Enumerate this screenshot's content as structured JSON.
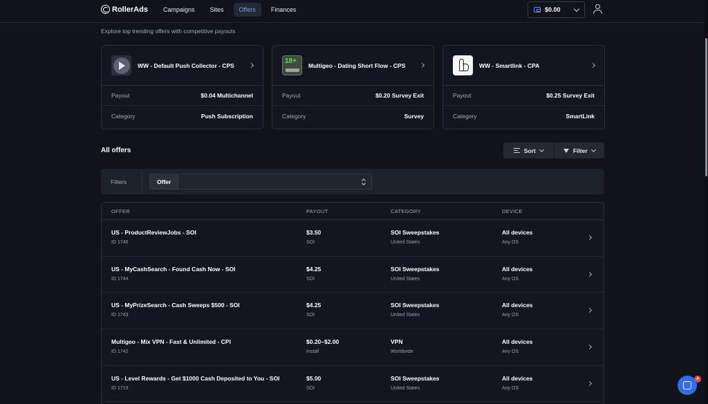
{
  "header": {
    "brand": "RollerAds",
    "nav": [
      "Campaigns",
      "Sites",
      "Offers",
      "Finances"
    ],
    "active_nav": "Offers",
    "balance": "$0.00"
  },
  "subtitle": "Explore top trending offers with competitive payouts",
  "top_offers": [
    {
      "title": "WW - Default Push Collector - CPS",
      "payout_label": "Payout",
      "payout": "$0.04 Multichannel",
      "category_label": "Category",
      "category": "Push Subscription",
      "icon": "play-icon"
    },
    {
      "title": "Multigeo - Dating Short Flow - CPS",
      "payout_label": "Payout",
      "payout": "$0.20 Survey Exit",
      "category_label": "Category",
      "category": "Survey",
      "icon": "18-plus-icon",
      "thumb_text": "18+"
    },
    {
      "title": "WW - Smartlink - CPA",
      "payout_label": "Payout",
      "payout": "$0.25 Survey Exit",
      "category_label": "Category",
      "category": "SmartLink",
      "icon": "pointer-hand-icon"
    }
  ],
  "all_offers": {
    "title": "All offers",
    "sort_label": "Sort",
    "filter_label": "Filter",
    "filters_label": "Filters",
    "offer_tag": "Offer",
    "columns": [
      "OFFER",
      "PAYOUT",
      "CATEGORY",
      "DEVICE"
    ],
    "rows": [
      {
        "name": "US - ProductReviewJobs - SOI",
        "id": "ID 1746",
        "payout": "$3.50",
        "payout_type": "SOI",
        "category": "SOI Sweepstakes",
        "geo": "United States",
        "device": "All devices",
        "os": "Any OS"
      },
      {
        "name": "US - MyCashSearch - Found Cash Now - SOI",
        "id": "ID 1744",
        "payout": "$4.25",
        "payout_type": "SOI",
        "category": "SOI Sweepstakes",
        "geo": "United States",
        "device": "All devices",
        "os": "Any OS"
      },
      {
        "name": "US - MyPrizeSearch - Cash Sweeps $500 - SOI",
        "id": "ID 1743",
        "payout": "$4.25",
        "payout_type": "SOI",
        "category": "SOI Sweepstakes",
        "geo": "United States",
        "device": "All devices",
        "os": "Any OS"
      },
      {
        "name": "Multigeo - Mix VPN - Fast & Unlimited - CPI",
        "id": "ID 1742",
        "payout": "$0.20–$2.00",
        "payout_type": "Install",
        "category": "VPN",
        "geo": "Worldwide",
        "device": "All devices",
        "os": "Any OS"
      },
      {
        "name": "US - Level Rewards - Get $1000 Cash Deposited to You - SOI",
        "id": "ID 1719",
        "payout": "$5.00",
        "payout_type": "SOI",
        "category": "SOI Sweepstakes",
        "geo": "United States",
        "device": "All devices",
        "os": "Any OS"
      }
    ]
  },
  "chat_badge": "4",
  "colors": {
    "background": "#101319",
    "accent": "#2f6df0",
    "active_nav": "#6f9bf0"
  }
}
